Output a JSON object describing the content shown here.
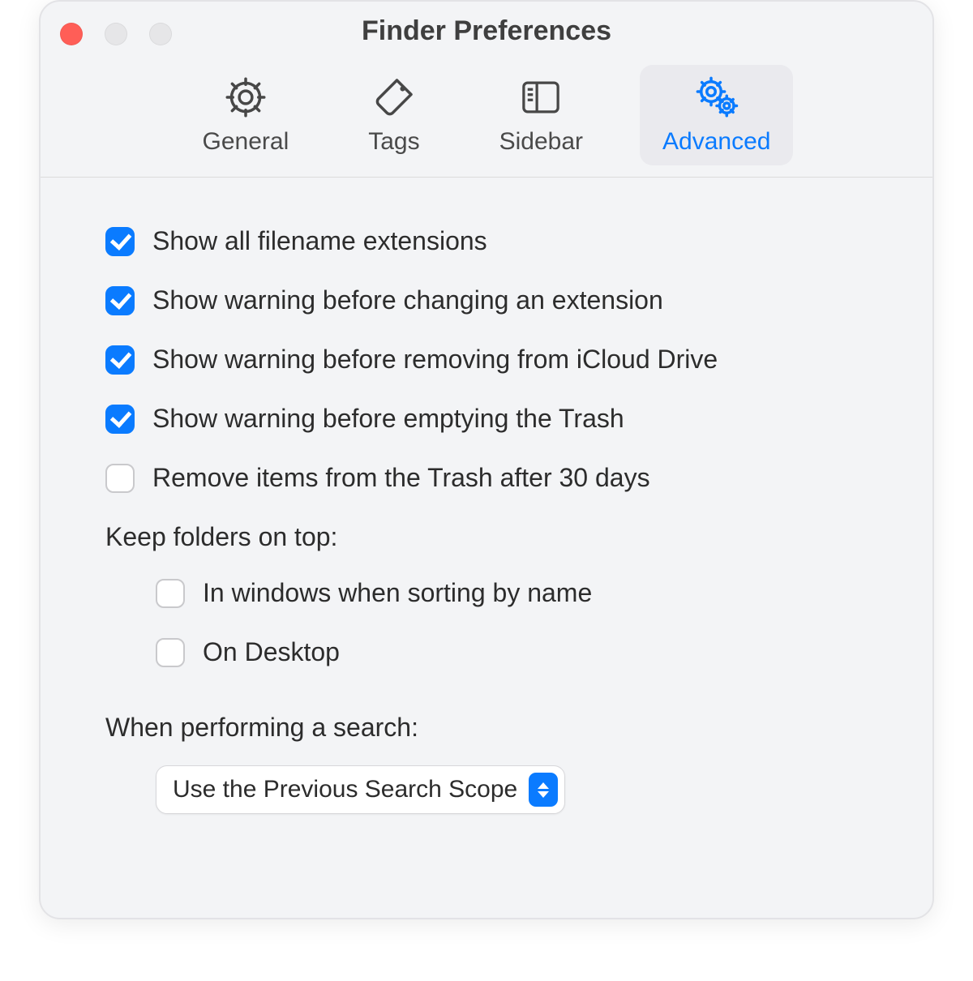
{
  "window": {
    "title": "Finder Preferences"
  },
  "tabs": [
    {
      "label": "General",
      "icon": "gear-icon",
      "selected": false
    },
    {
      "label": "Tags",
      "icon": "tag-icon",
      "selected": false
    },
    {
      "label": "Sidebar",
      "icon": "sidebar-icon",
      "selected": false
    },
    {
      "label": "Advanced",
      "icon": "gears-icon",
      "selected": true
    }
  ],
  "options": [
    {
      "label": "Show all filename extensions",
      "checked": true
    },
    {
      "label": "Show warning before changing an extension",
      "checked": true
    },
    {
      "label": "Show warning before removing from iCloud Drive",
      "checked": true
    },
    {
      "label": "Show warning before emptying the Trash",
      "checked": true
    },
    {
      "label": "Remove items from the Trash after 30 days",
      "checked": false
    }
  ],
  "keep_folders": {
    "heading": "Keep folders on top:",
    "items": [
      {
        "label": "In windows when sorting by name",
        "checked": false
      },
      {
        "label": "On Desktop",
        "checked": false
      }
    ]
  },
  "search": {
    "heading": "When performing a search:",
    "selected": "Use the Previous Search Scope"
  },
  "colors": {
    "accent": "#0a7bff",
    "close_button": "#ff5e57"
  }
}
